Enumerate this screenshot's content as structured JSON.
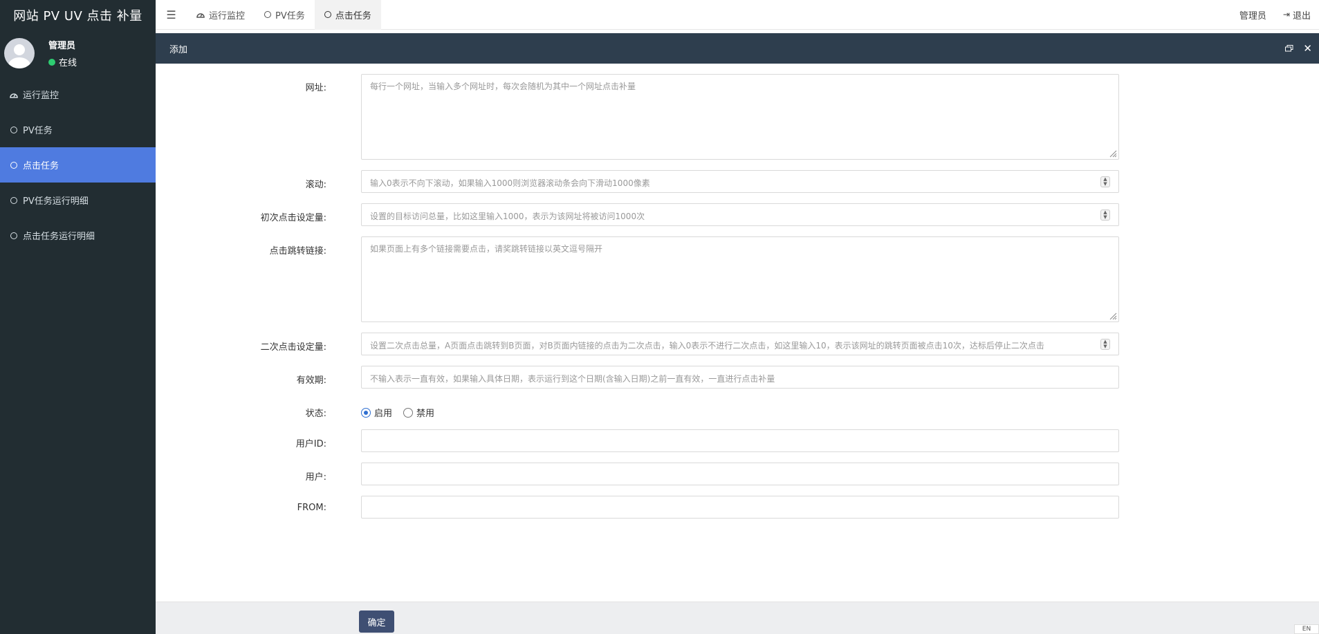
{
  "app": {
    "brand": "网站 PV UV 点击 补量"
  },
  "user": {
    "name": "管理员",
    "status": "在线"
  },
  "sidebar": {
    "items": [
      {
        "label": "运行监控",
        "icon": "dashboard-icon"
      },
      {
        "label": "PV任务",
        "icon": "circle-icon"
      },
      {
        "label": "点击任务",
        "icon": "circle-icon",
        "active": true
      },
      {
        "label": "PV任务运行明细",
        "icon": "circle-icon"
      },
      {
        "label": "点击任务运行明细",
        "icon": "circle-icon"
      }
    ]
  },
  "topbar": {
    "tabs": [
      {
        "label": "运行监控",
        "icon": "dashboard-icon"
      },
      {
        "label": "PV任务",
        "icon": "circle-icon"
      },
      {
        "label": "点击任务",
        "icon": "circle-icon",
        "active": true
      }
    ],
    "user_label": "管理员",
    "logout_label": "退出"
  },
  "panel": {
    "title": "添加"
  },
  "form": {
    "url": {
      "label": "网址:",
      "placeholder": "每行一个网址，当输入多个网址时，每次会随机为其中一个网址点击补量"
    },
    "scroll": {
      "label": "滚动:",
      "placeholder": "输入0表示不向下滚动，如果输入1000则浏览器滚动条会向下滑动1000像素"
    },
    "initial_clicks": {
      "label": "初次点击设定量:",
      "placeholder": "设置的目标访问总量，比如这里输入1000，表示为该网址将被访问1000次"
    },
    "jump_links": {
      "label": "点击跳转链接:",
      "placeholder": "如果页面上有多个链接需要点击，请奖跳转链接以英文逗号隔开"
    },
    "second_clicks": {
      "label": "二次点击设定量:",
      "placeholder": "设置二次点击总量，A页面点击跳转到B页面，对B页面内链接的点击为二次点击，输入0表示不进行二次点击，如这里输入10，表示该网址的跳转页面被点击10次，达标后停止二次点击"
    },
    "validity": {
      "label": "有效期:",
      "placeholder": "不输入表示一直有效，如果输入具体日期，表示运行到这个日期(含输入日期)之前一直有效，一直进行点击补量"
    },
    "status": {
      "label": "状态:",
      "options": [
        "启用",
        "禁用"
      ],
      "selected": "启用"
    },
    "user_id": {
      "label": "用户ID:",
      "value": ""
    },
    "user": {
      "label": "用户:",
      "value": ""
    },
    "from": {
      "label": "FROM:",
      "value": ""
    }
  },
  "footer": {
    "confirm_label": "确定",
    "ime": "EN"
  },
  "colors": {
    "sidebar_bg": "#222d32",
    "active_item": "#4f7be0",
    "panel_header": "#2e3e4e",
    "button": "#3f4f73"
  }
}
